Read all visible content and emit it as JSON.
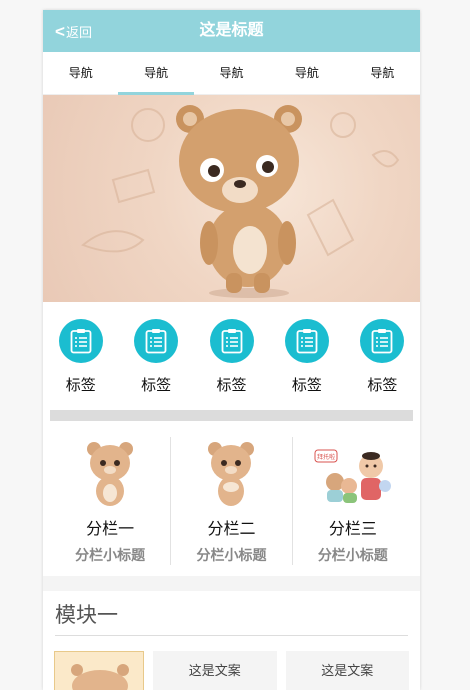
{
  "header": {
    "back_label": "返回",
    "title": "这是标题"
  },
  "nav": {
    "items": [
      "导航",
      "导航",
      "导航",
      "导航",
      "导航"
    ],
    "active_index": 1
  },
  "tags": {
    "items": [
      "标签",
      "标签",
      "标签",
      "标签",
      "标签"
    ]
  },
  "columns": {
    "items": [
      {
        "title": "分栏一",
        "subtitle": "分栏小标题"
      },
      {
        "title": "分栏二",
        "subtitle": "分栏小标题"
      },
      {
        "title": "分栏三",
        "subtitle": "分栏小标题"
      }
    ]
  },
  "sticker_text": "拜托啦",
  "module": {
    "title": "模块一",
    "cards": [
      "这是文案",
      "这是文案"
    ]
  },
  "colors": {
    "header": "#92d4dc",
    "tag_icon": "#1bbdd0",
    "accent": "#92d4dc"
  }
}
